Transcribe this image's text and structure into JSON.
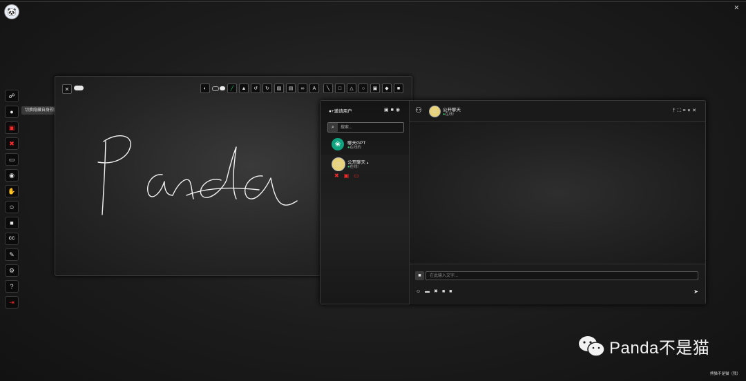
{
  "tooltip": {
    "text": "切换隐藏自身视图"
  },
  "icons": {
    "app_logo": "panda-logo-icon",
    "top_right": "mic-off-icon"
  },
  "left_toolbar": [
    {
      "name": "share-icon",
      "glyph": "⚯"
    },
    {
      "name": "user-icon",
      "glyph": "👤"
    },
    {
      "name": "camera-off-icon",
      "glyph": "▰",
      "color": "#ff2a2a"
    },
    {
      "name": "mic-off-icon",
      "glyph": "🎙",
      "color": "#ff2a2a"
    },
    {
      "name": "screen-share-icon",
      "glyph": "🖥"
    },
    {
      "name": "record-icon",
      "glyph": "⦿"
    },
    {
      "name": "hand-icon",
      "glyph": "✋",
      "color": "#19d36b"
    },
    {
      "name": "emoji-icon",
      "glyph": "☺"
    },
    {
      "name": "chat-icon",
      "glyph": "💬"
    },
    {
      "name": "captions-icon",
      "glyph": "CC"
    },
    {
      "name": "whiteboard-icon",
      "glyph": "✎"
    },
    {
      "name": "settings-icon",
      "glyph": "⚙"
    },
    {
      "name": "help-icon",
      "glyph": "?"
    },
    {
      "name": "exit-icon",
      "glyph": "⇥",
      "color": "#ff2a2a"
    }
  ],
  "whiteboard": {
    "handwriting": "Panda",
    "tools": [
      "contrast-icon",
      "pencil-icon",
      "pointer-icon",
      "undo-icon",
      "redo-icon",
      "image-icon",
      "pdf-icon",
      "link-icon",
      "text-icon",
      "line-icon",
      "square-icon",
      "triangle-icon",
      "circle-icon",
      "save-icon",
      "eraser-icon",
      "trash-icon"
    ]
  },
  "chat": {
    "invite_label": "邀请用户",
    "search_placeholder": "搜索...",
    "contacts": [
      {
        "name": "聊天GPT",
        "status": "在线的"
      },
      {
        "name": "公开聊天",
        "status": "在线!"
      }
    ],
    "header_title": "公开聊天",
    "header_status": "在线!",
    "message_placeholder": "在此输入文字..."
  },
  "watermark": {
    "text": "Panda不是猫"
  },
  "footer_credit": "熊猫不是猫（我）",
  "colors": {
    "accent_red": "#ff2a2a",
    "accent_green": "#2ad36b",
    "gpt_green": "#10a37f"
  }
}
